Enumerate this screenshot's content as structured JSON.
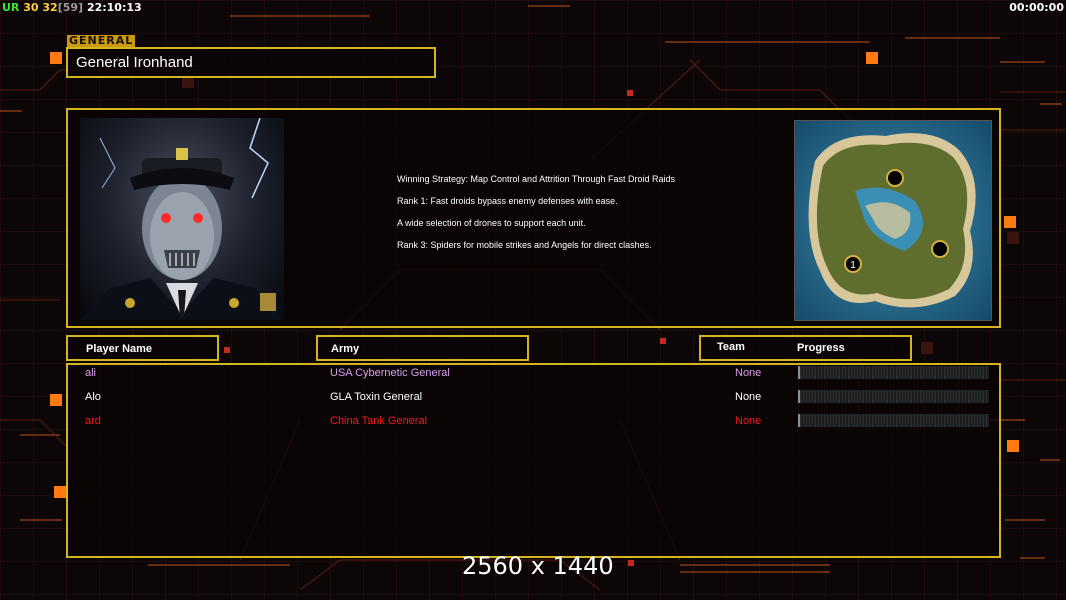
{
  "hud": {
    "ur_label": "UR",
    "ur_value1": "30",
    "ur_value2": "32",
    "ur_bracket": "[59]",
    "clock": "22:10:13",
    "timer": "00:00:00"
  },
  "general": {
    "section_label": "GENERAL",
    "name": "General Ironhand",
    "portrait_icon": "cyborg-general-portrait"
  },
  "strategy": {
    "lines": [
      "Winning Strategy: Map Control and Attrition Through Fast Droid Raids",
      "Rank 1: Fast droids bypass enemy defenses with ease.",
      "A wide selection of drones to support each unit.",
      "Rank 3: Spiders for mobile strikes and Angels for direct clashes."
    ]
  },
  "minimap": {
    "icon": "island-minimap",
    "start_marker": "1"
  },
  "table": {
    "headers": {
      "player": "Player Name",
      "army": "Army",
      "team": "Team",
      "progress": "Progress"
    },
    "rows": [
      {
        "player": "ali",
        "army": "USA Cybernetic General",
        "team": "None",
        "color": "#d8a0f0",
        "progress": 0.0
      },
      {
        "player": "Alo",
        "army": "GLA Toxin General",
        "team": "None",
        "color": "#ffffff",
        "progress": 0.0
      },
      {
        "player": "ard",
        "army": "China Tank General",
        "team": "None",
        "color": "#ee1c1c",
        "progress": 0.0
      }
    ]
  },
  "colors": {
    "frame": "#d4b41f",
    "accent_orange": "#ff7a12",
    "ur_green": "#38e838",
    "ur_yellow": "#ffd23c"
  },
  "watermark": "2560 x 1440"
}
